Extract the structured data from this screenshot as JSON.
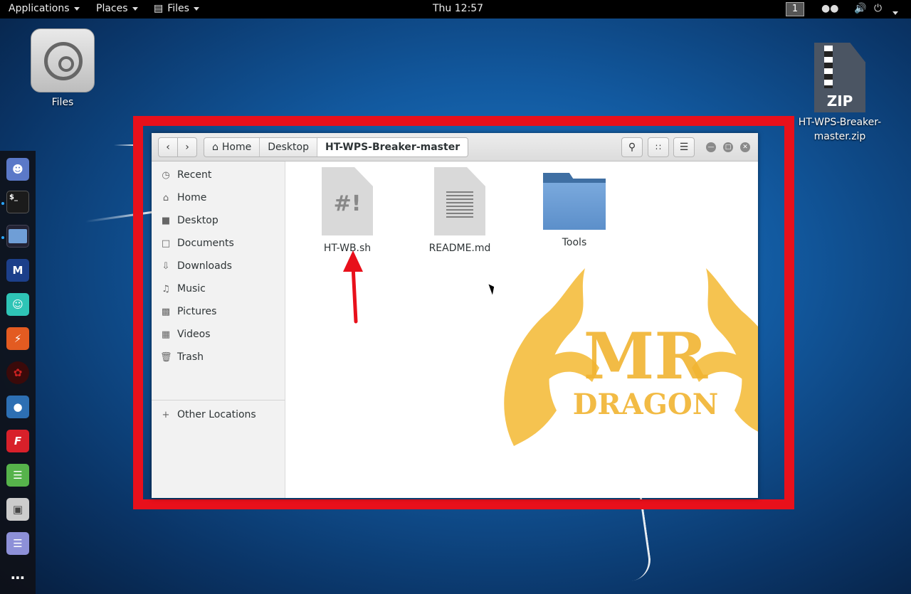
{
  "topbar": {
    "applications": "Applications",
    "places": "Places",
    "files": "Files",
    "clock": "Thu 12:57",
    "workspace": "1"
  },
  "desktop": {
    "files_label": "Files",
    "zip_badge": "ZIP",
    "zip_label_line1": "HT-WPS-Breaker-",
    "zip_label_line2": "master.zip"
  },
  "window": {
    "breadcrumbs": [
      "Home",
      "Desktop",
      "HT-WPS-Breaker-master"
    ],
    "sidebar": [
      "Recent",
      "Home",
      "Desktop",
      "Documents",
      "Downloads",
      "Music",
      "Pictures",
      "Videos",
      "Trash"
    ],
    "other_locations": "Other Locations",
    "files": [
      {
        "name": "HT-WB.sh",
        "type": "script-icon"
      },
      {
        "name": "README.md",
        "type": "text-document-icon"
      },
      {
        "name": "Tools",
        "type": "folder-icon"
      }
    ]
  },
  "watermark": {
    "line1": "MR",
    "line2": "DRAGON"
  },
  "colors": {
    "highlight": "#e8101b",
    "accent": "#2aa6ff"
  }
}
